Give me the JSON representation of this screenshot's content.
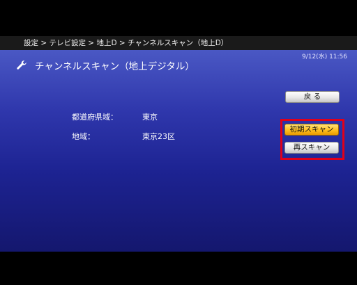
{
  "breadcrumb": "設定 > テレビ設定 > 地上D > チャンネルスキャン（地上D）",
  "datetime": "9/12(水) 11:56",
  "title": "チャンネルスキャン（地上デジタル）",
  "fields": {
    "prefecture_label": "都道府県域：",
    "prefecture_value": "東京",
    "area_label": "地域：",
    "area_value": "東京23区"
  },
  "buttons": {
    "back": "戻 る",
    "initial_scan": "初期スキャン",
    "rescan": "再スキャン"
  },
  "colors": {
    "highlight": "#e0001a",
    "focused_button": "#ffc020",
    "background_top": "#4a58c4",
    "background_bottom": "#14176e"
  },
  "icons": {
    "title_icon": "wrench-icon"
  }
}
